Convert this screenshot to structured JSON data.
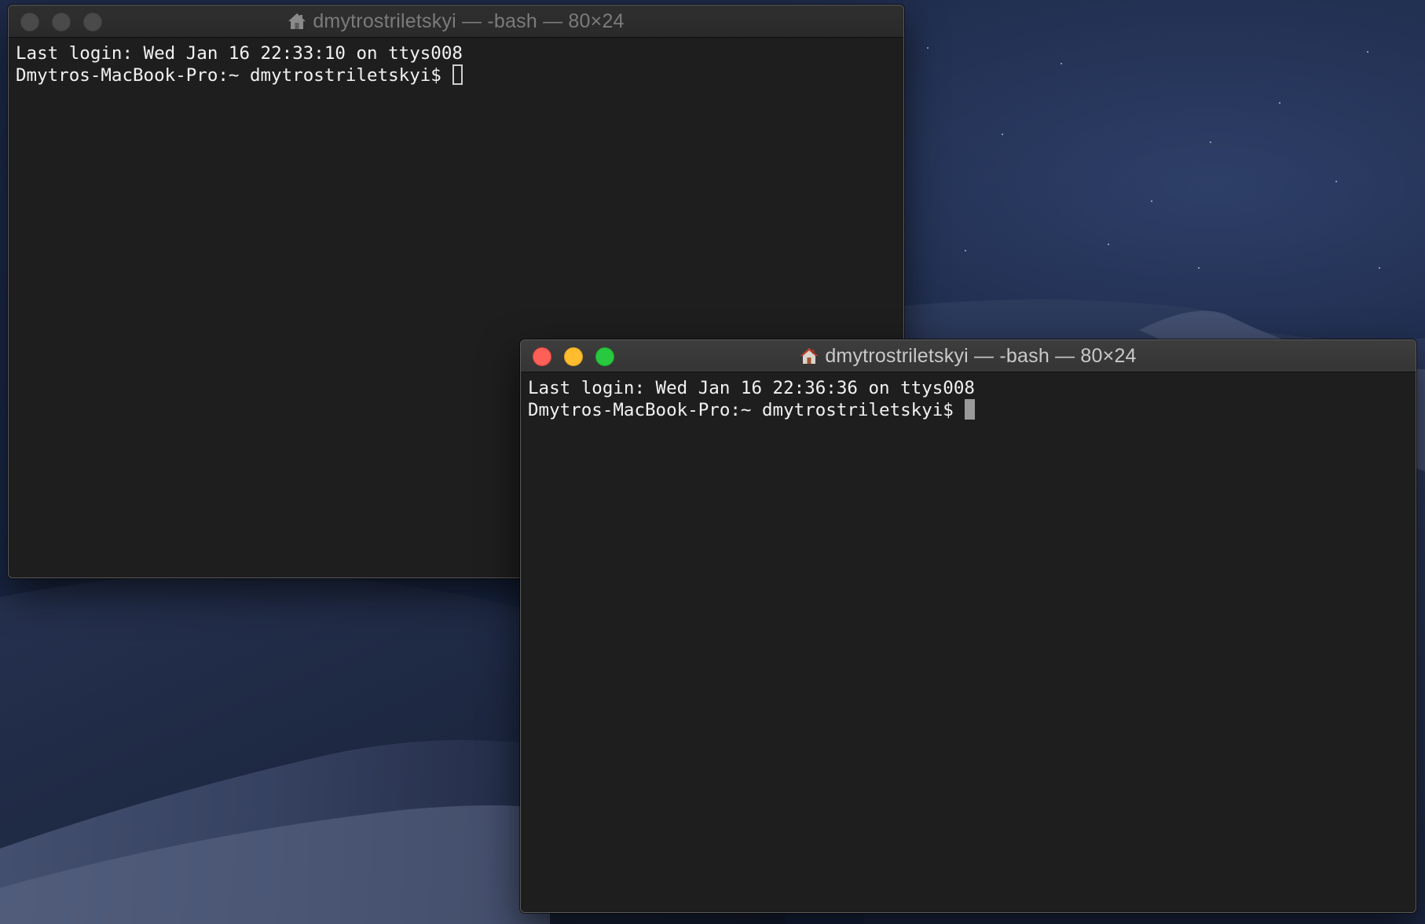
{
  "desktop": {
    "wallpaper": "macOS Mojave dark desert dunes"
  },
  "windows": [
    {
      "state": "inactive",
      "title": "dmytrostriletskyi — -bash — 80×24",
      "icon": "home-icon",
      "lines": [
        "Last login: Wed Jan 16 22:33:10 on ttys008",
        "Dmytros-MacBook-Pro:~ dmytrostriletskyi$ "
      ],
      "cursor_style": "hollow"
    },
    {
      "state": "active",
      "title": "dmytrostriletskyi — -bash — 80×24",
      "icon": "home-icon",
      "lines": [
        "Last login: Wed Jan 16 22:36:36 on ttys008",
        "Dmytros-MacBook-Pro:~ dmytrostriletskyi$ "
      ],
      "cursor_style": "solid"
    }
  ],
  "colors": {
    "terminal_bg": "#1e1e1e",
    "terminal_text": "#f2f2f2",
    "close": "#fe5f57",
    "minimize": "#febc2e",
    "maximize": "#28c840"
  }
}
